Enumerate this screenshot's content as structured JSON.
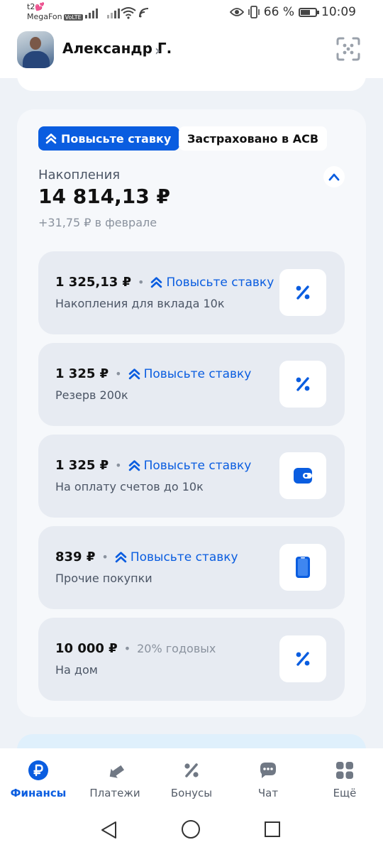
{
  "status_bar": {
    "carrier_top": "t2💕",
    "carrier_bottom": "MegaFon",
    "volte": "VoLTE",
    "battery_text": "66 %",
    "battery_level": 0.66,
    "time": "10:09"
  },
  "header": {
    "user_name": "Александр Г.",
    "chevron": "›",
    "avatar_icon": "user-photo",
    "qr_icon": "qr-scan-icon"
  },
  "savings": {
    "boost_chip_label": "Повысьте ставку",
    "insured_chip_label": "Застраховано в АСВ",
    "label": "Накопления",
    "total": "14 814,13 ₽",
    "change": "+31,75 ₽ в феврале",
    "accounts": [
      {
        "amount": "1 325,13 ₽",
        "dot": "•",
        "boost": "Повысьте ставку",
        "name": "Накопления для вклада 10к",
        "icon": "percent-icon"
      },
      {
        "amount": "1 325 ₽",
        "dot": "•",
        "boost": "Повысьте ставку",
        "name": "Резерв 200к",
        "icon": "percent-icon"
      },
      {
        "amount": "1 325 ₽",
        "dot": "•",
        "boost": "Повысьте ставку",
        "name": "На оплату счетов до 10к",
        "icon": "wallet-icon"
      },
      {
        "amount": "839 ₽",
        "dot": "•",
        "boost": "Повысьте ставку",
        "name": "Прочие покупки",
        "icon": "phone-icon"
      },
      {
        "amount": "10 000 ₽",
        "dot": "•",
        "rate": "20% годовых",
        "name": "На дом",
        "icon": "percent-icon"
      }
    ]
  },
  "nav": {
    "items": [
      {
        "label": "Финансы",
        "icon": "ruble-icon",
        "active": true
      },
      {
        "label": "Платежи",
        "icon": "transfer-arrows-icon"
      },
      {
        "label": "Бонусы",
        "icon": "percent-icon"
      },
      {
        "label": "Чат",
        "icon": "chat-icon"
      },
      {
        "label": "Ещё",
        "icon": "grid-icon"
      }
    ]
  },
  "colors": {
    "accent": "#0a5de0",
    "card_bg": "#e7ebf2",
    "page_bg": "#eef2f7"
  }
}
